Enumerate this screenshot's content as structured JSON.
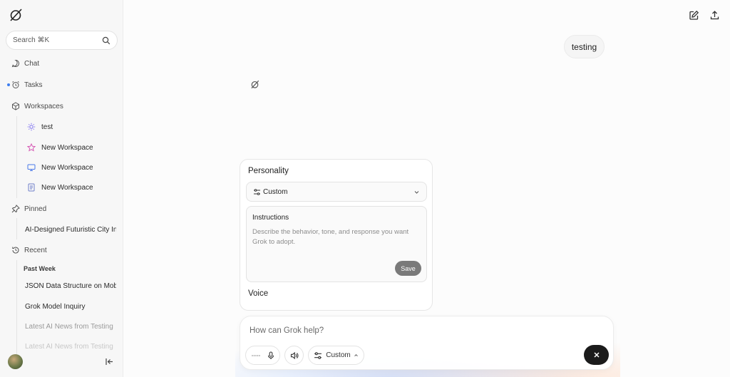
{
  "sidebar": {
    "search": {
      "label": "Search ⌘K"
    },
    "nav": {
      "chat": "Chat",
      "tasks": "Tasks",
      "workspaces": "Workspaces",
      "pinned": "Pinned",
      "recent": "Recent"
    },
    "workspace_items": [
      {
        "label": "test",
        "icon": "sun-icon",
        "color": "#7b6ef0"
      },
      {
        "label": "New Workspace",
        "icon": "star-icon",
        "color": "#d65bb5"
      },
      {
        "label": "New Workspace",
        "icon": "monitor-icon",
        "color": "#4a78e8"
      },
      {
        "label": "New Workspace",
        "icon": "document-icon",
        "color": "#6f7fc9"
      }
    ],
    "pinned_items": [
      {
        "label": "AI-Designed Futuristic City In"
      }
    ],
    "recent_section": "Past Week",
    "recent_items": [
      {
        "label": "JSON Data Structure on Mob"
      },
      {
        "label": "Grok Model Inquiry"
      },
      {
        "label": "Latest AI News from Testing"
      },
      {
        "label": "Latest AI News from Testing"
      }
    ]
  },
  "chat": {
    "user_message": "testing"
  },
  "personality_panel": {
    "title": "Personality",
    "selected": "Custom",
    "instructions_label": "Instructions",
    "instructions_placeholder": "Describe the behavior, tone, and response you want Grok to adopt.",
    "save_label": "Save",
    "voice_label": "Voice"
  },
  "composer": {
    "placeholder": "How can Grok help?",
    "mode_label": "Custom"
  },
  "colors": {
    "accent_dot": "#3d7ef0",
    "save_button": "#7a7a7a",
    "stop_button": "#1b1b1b"
  }
}
